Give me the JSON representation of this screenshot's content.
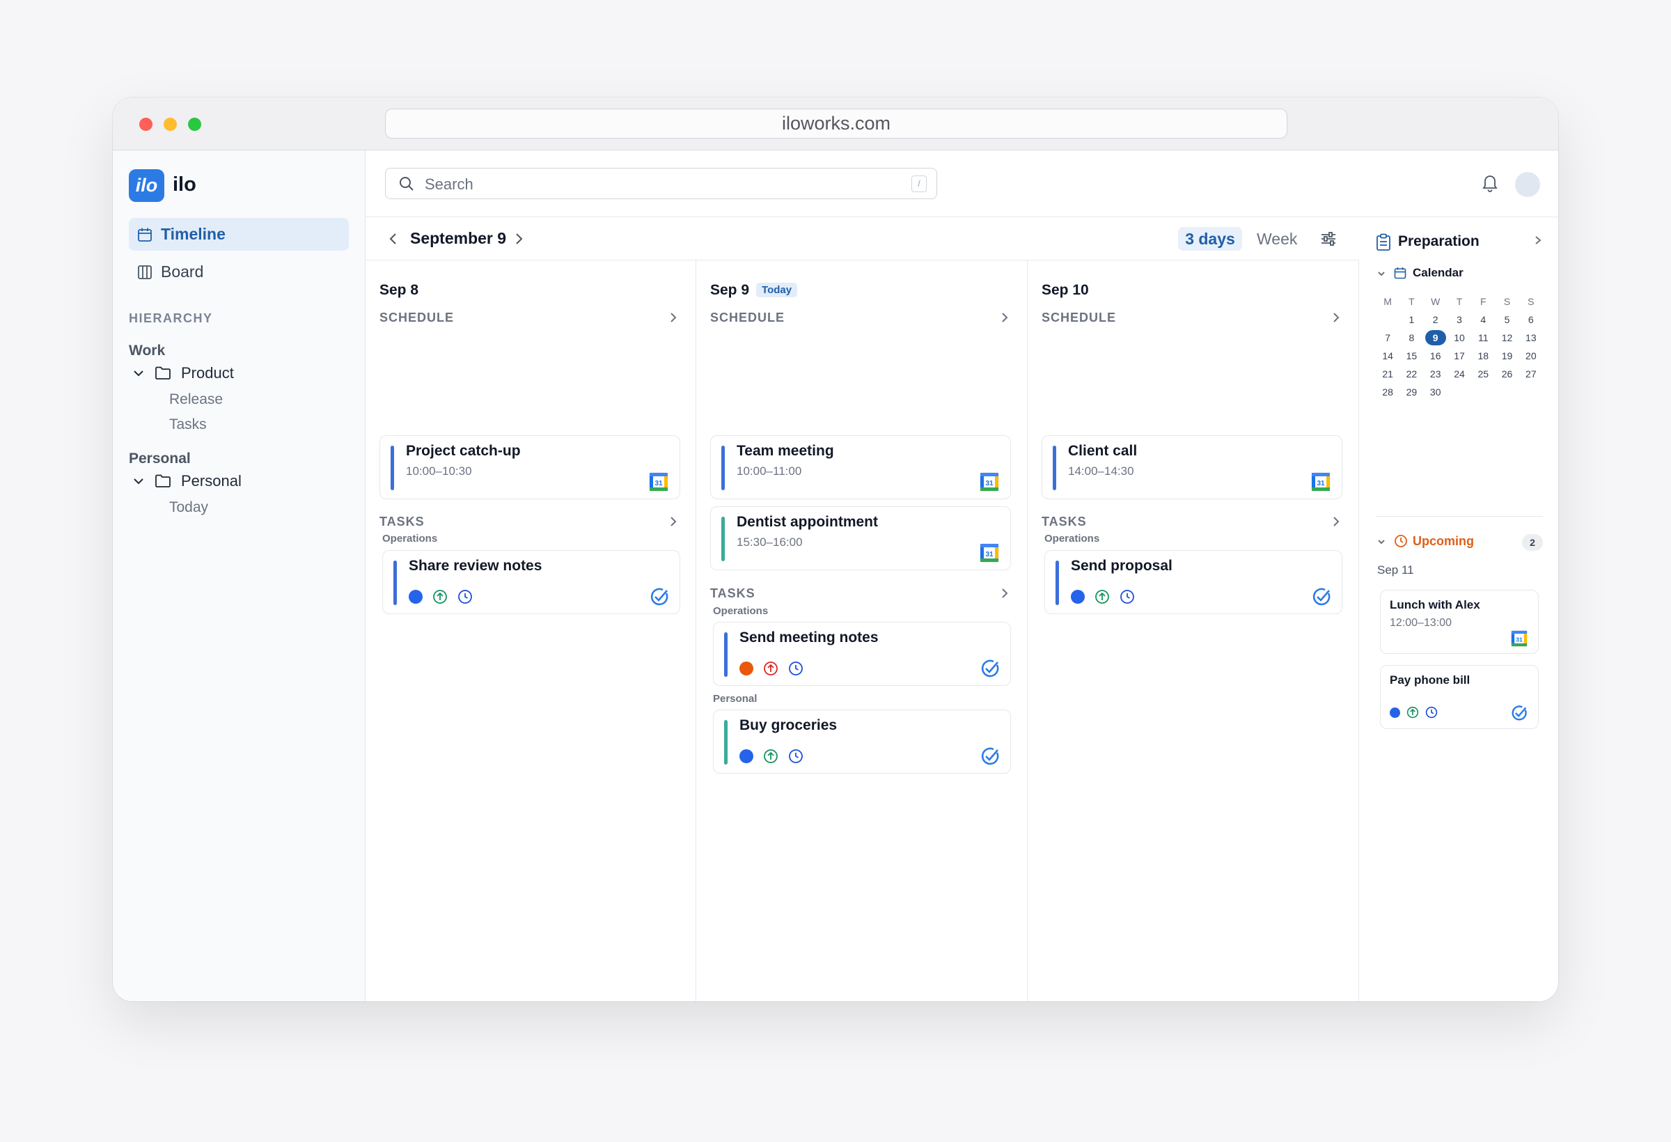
{
  "browser": {
    "url": "iloworks.com"
  },
  "app": {
    "logo_text": "ilo",
    "name": "ilo"
  },
  "sidebar": {
    "nav": [
      {
        "label": "Timeline"
      },
      {
        "label": "Board"
      }
    ],
    "hierarchy_title": "HIERARCHY",
    "groups": [
      {
        "label": "Work",
        "folder": "Product",
        "items": [
          "Release",
          "Tasks"
        ]
      },
      {
        "label": "Personal",
        "folder": "Personal",
        "items": [
          "Today"
        ]
      }
    ]
  },
  "topbar": {
    "search_placeholder": "Search",
    "search_shortcut": "/"
  },
  "datebar": {
    "title": "September 9",
    "view_3days": "3 days",
    "view_week": "Week"
  },
  "days": [
    {
      "label": "Sep 8",
      "schedule_label": "SCHEDULE",
      "events": [
        {
          "title": "Project catch-up",
          "time": "10:00–10:30"
        }
      ],
      "tasks_label": "TASKS",
      "task_groups": [
        {
          "label": "Operations",
          "tasks": [
            {
              "title": "Share review notes"
            }
          ]
        }
      ]
    },
    {
      "label": "Sep 9",
      "badge": "Today",
      "schedule_label": "SCHEDULE",
      "events": [
        {
          "title": "Team meeting",
          "time": "10:00–11:00"
        },
        {
          "title": "Dentist appointment",
          "time": "15:30–16:00"
        }
      ],
      "tasks_label": "TASKS",
      "task_groups": [
        {
          "label": "Operations",
          "tasks": [
            {
              "title": "Send meeting notes"
            }
          ]
        },
        {
          "label": "Personal",
          "tasks": [
            {
              "title": "Buy groceries"
            }
          ]
        }
      ]
    },
    {
      "label": "Sep 10",
      "schedule_label": "SCHEDULE",
      "events": [
        {
          "title": "Client call",
          "time": "14:00–14:30"
        }
      ],
      "tasks_label": "TASKS",
      "task_groups": [
        {
          "label": "Operations",
          "tasks": [
            {
              "title": "Send proposal"
            }
          ]
        }
      ]
    }
  ],
  "icons": {
    "calendar_badge_text": "31",
    "status_dot_blue": "#2563eb",
    "status_dot_orange": "#ea580c",
    "priority_green": "#16935f",
    "priority_red": "#dc2626",
    "accent": "#1f5fa8"
  },
  "panel": {
    "title": "Preparation",
    "calendar_label": "Calendar",
    "weekdays": [
      "M",
      "T",
      "W",
      "T",
      "F",
      "S",
      "S"
    ],
    "weeks": [
      [
        "",
        "1",
        "2",
        "3",
        "4",
        "5",
        "6"
      ],
      [
        "7",
        "8",
        "9",
        "10",
        "11",
        "12",
        "13"
      ],
      [
        "14",
        "15",
        "16",
        "17",
        "18",
        "19",
        "20"
      ],
      [
        "21",
        "22",
        "23",
        "24",
        "25",
        "26",
        "27"
      ],
      [
        "28",
        "29",
        "30",
        "",
        "",
        "",
        ""
      ]
    ],
    "selected_day": "9",
    "upcoming_label": "Upcoming",
    "upcoming_count": "2",
    "upcoming_date": "Sep 11",
    "upcoming": [
      {
        "title": "Lunch with Alex",
        "time": "12:00–13:00"
      },
      {
        "title": "Pay phone bill"
      }
    ]
  }
}
